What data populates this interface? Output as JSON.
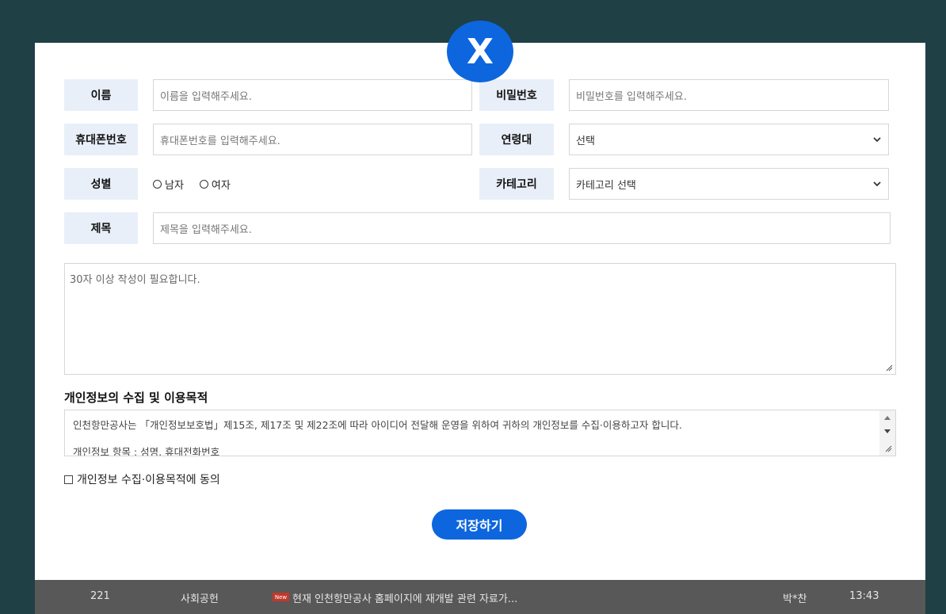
{
  "modal": {
    "close_label": "X",
    "fields": {
      "name": {
        "label": "이름",
        "placeholder": "이름을 입력해주세요."
      },
      "password": {
        "label": "비밀번호",
        "placeholder": "비밀번호를 입력해주세요."
      },
      "phone": {
        "label": "휴대폰번호",
        "placeholder": "휴대폰번호를 입력해주세요."
      },
      "age": {
        "label": "연령대",
        "selected": "선택"
      },
      "gender": {
        "label": "성별",
        "options": [
          "남자",
          "여자"
        ]
      },
      "category": {
        "label": "카테고리",
        "selected": "카테고리 선택"
      },
      "title": {
        "label": "제목",
        "placeholder": "제목을 입력해주세요."
      }
    },
    "content_placeholder": "30자 이상 작성이 필요합니다.",
    "privacy": {
      "title": "개인정보의 수집 및 이용목적",
      "line1": "인천항만공사는 「개인정보보호법」제15조, 제17조 및 제22조에 따라 아이디어 전달해 운영을 위하여 귀하의 개인정보를 수집·이용하고자 합니다.",
      "line2": "개인정보 항목 : 성명, 휴대전화번호",
      "agree_label": "개인정보 수집·이용목적에 동의"
    },
    "save_label": "저장하기"
  },
  "background_row": {
    "number": "221",
    "category": "사회공헌",
    "badge": "New",
    "title": "현재 인천항만공사 홈페이지에 재개발 관련 자료가...",
    "author": "박*찬",
    "time": "13:43"
  },
  "colors": {
    "accent": "#0d66de",
    "label_bg": "#e9eff9",
    "page_bg": "#1f4045"
  }
}
